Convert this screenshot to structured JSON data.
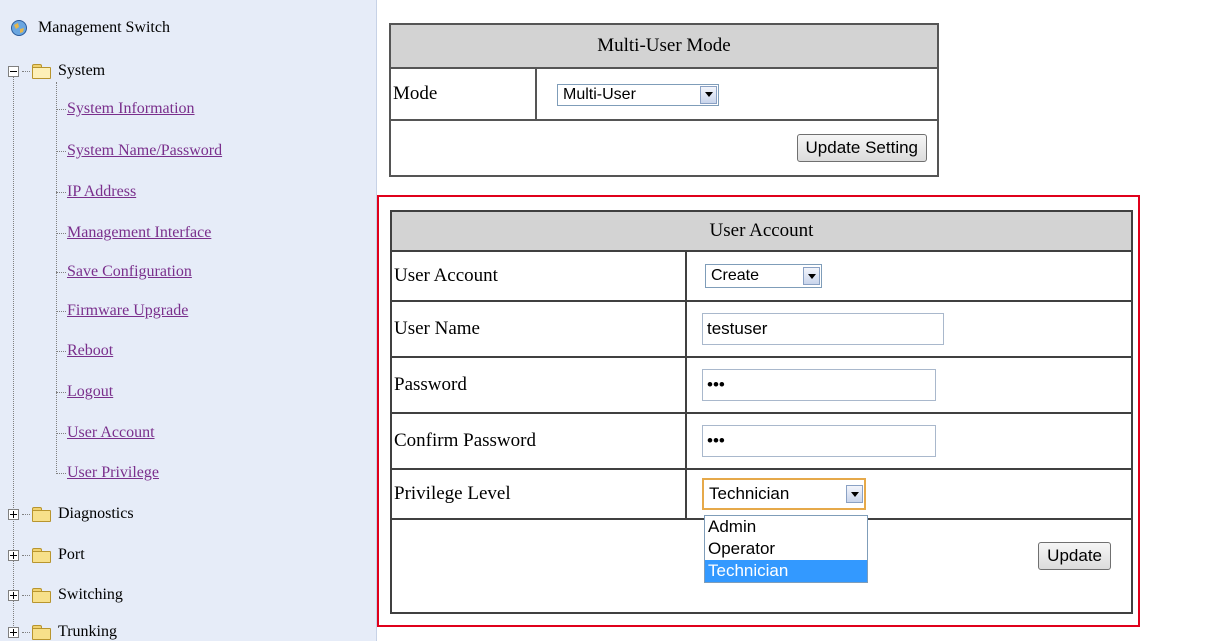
{
  "tree": {
    "root": "Management Switch",
    "system": {
      "label": "System",
      "items": [
        "System Information",
        "System Name/Password",
        "IP Address",
        "Management Interface",
        "Save Configuration",
        "Firmware Upgrade",
        "Reboot",
        "Logout",
        "User Account",
        "User Privilege"
      ]
    },
    "folders": [
      "Diagnostics",
      "Port",
      "Switching",
      "Trunking"
    ]
  },
  "multi_user": {
    "title": "Multi-User Mode",
    "mode_label": "Mode",
    "mode_value": "Multi-User",
    "update_button": "Update Setting"
  },
  "user_account": {
    "title": "User Account",
    "account_label": "User Account",
    "account_value": "Create",
    "username_label": "User Name",
    "username_value": "testuser",
    "password_label": "Password",
    "password_value": "•••",
    "confirm_label": "Confirm Password",
    "confirm_value": "•••",
    "privilege_label": "Privilege Level",
    "privilege_value": "Technician",
    "privilege_options": [
      "Admin",
      "Operator",
      "Technician"
    ],
    "update_button": "Update"
  },
  "colors": {
    "highlight_box": "#e0001b",
    "header_bg": "#d3d3d3",
    "link": "#7a2f8c",
    "selected_option": "#3399ff"
  },
  "icons": {
    "root": "globe-icon",
    "folder": "folder-icon",
    "expander": "tree-expander-icon"
  }
}
